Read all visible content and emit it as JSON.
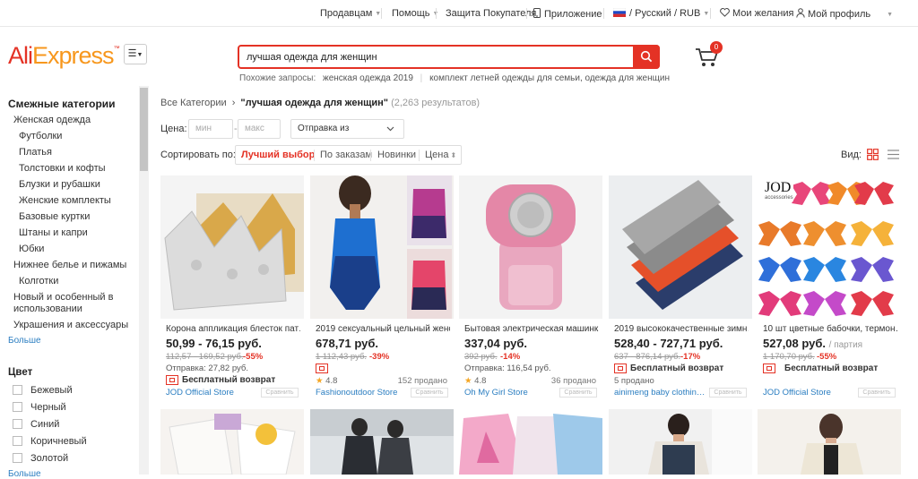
{
  "topbar": {
    "sell": "Продавцам",
    "help": "Помощь",
    "protection": "Защита Покупателя",
    "app": "Приложение",
    "region": "/ Русский / RUB",
    "wishlist": "Мои желания",
    "profile": "Мой профиль"
  },
  "logo": {
    "part1": "Ali",
    "part2": "Express",
    "mark": "™"
  },
  "search": {
    "value": "лучшая одежда для женщин",
    "suggest_label": "Похожие запросы:",
    "suggestions": [
      "женская одежда 2019",
      "комплект летней одежды для семьи, одежда для женщин"
    ]
  },
  "cart": {
    "count": "0"
  },
  "sidebar": {
    "title": "Смежные категории",
    "top_category": "Женская одежда",
    "subcategories": [
      "Футболки",
      "Платья",
      "Толстовки и кофты",
      "Блузки и рубашки",
      "Женские комплекты",
      "Базовые куртки",
      "Штаны и капри",
      "Юбки"
    ],
    "cat2": "Нижнее белье и пижамы",
    "cat2_sub": "Колготки",
    "cat3_line1": "Новый и особенный в",
    "cat3_line2": "использовании",
    "cat4": "Украшения и аксессуары",
    "more": "Больше",
    "color_title": "Цвет",
    "colors": [
      "Бежевый",
      "Черный",
      "Синий",
      "Коричневый",
      "Золотой"
    ],
    "more2": "Больше"
  },
  "breadcrumb": {
    "root": "Все Категории",
    "sep": "›",
    "query": "\"лучшая одежда для женщин\"",
    "count": "(2,263 результатов)"
  },
  "filters": {
    "price_label": "Цена:",
    "min_placeholder": "мин",
    "max_placeholder": "макс",
    "dash": "-",
    "ship_from": "Отправка из"
  },
  "sort": {
    "label": "Сортировать по:",
    "best": "Лучший выбор",
    "orders": "По заказам",
    "new": "Новинки",
    "price": "Цена",
    "view_label": "Вид:"
  },
  "products": [
    {
      "title": "Корона аппликация блесток пат…",
      "price": "50,99 - 76,15 руб.",
      "old": "112,57 - 169,52 руб.",
      "disc": "-55%",
      "ship": "Отправка: 27,82 руб.",
      "free": "Бесплатный возврат",
      "store": "JOD Official Store",
      "cmp": "Сравнить"
    },
    {
      "title": "2019 сексуальный цельный женс…",
      "price": "678,71 руб.",
      "old": "1 112,43 руб.",
      "disc": "-39%",
      "rating": "4.8",
      "sold": "152 продано",
      "store": "Fashionoutdoor Store",
      "cmp": "Сравнить"
    },
    {
      "title": "Бытовая электрическая машинк…",
      "price": "337,04 руб.",
      "old": "392 руб.",
      "disc": "-14%",
      "ship": "Отправка: 116,54 руб.",
      "rating": "4.8",
      "sold": "36 продано",
      "store": "Oh My Girl Store",
      "cmp": "Сравнить"
    },
    {
      "title": "2019 высококачественные зимн…",
      "price": "528,40 - 727,71 руб.",
      "old": "637 - 876,14 руб.",
      "disc": "-17%",
      "free": "Бесплатный возврат",
      "sold": "5 продано",
      "store": "ainimeng baby clothin…",
      "cmp": "Сравнить"
    },
    {
      "title": "10 шт цветные бабочки, термон…",
      "price": "527,08 руб.",
      "unit": "/ партия",
      "old": "1 170,70 руб.",
      "disc": "-55%",
      "free": "Бесплатный возврат",
      "store": "JOD Official Store",
      "cmp": "Сравнить",
      "brand": "JOD",
      "brand_sub": "accessories"
    }
  ],
  "colors": {
    "accent": "#e43225",
    "link": "#2b7ec1",
    "orange": "#f7971d"
  }
}
